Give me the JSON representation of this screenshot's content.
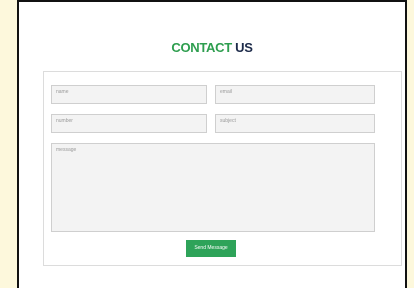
{
  "contact": {
    "title_part1": "CONTACT",
    "title_part2": "US",
    "fields": {
      "name_placeholder": "name",
      "email_placeholder": "email",
      "number_placeholder": "number",
      "subject_placeholder": "subject",
      "message_placeholder": "message"
    },
    "submit_label": "Send Message"
  },
  "colors": {
    "accent_green": "#2e9e4f",
    "title_dark": "#1d2b4a",
    "button_green": "#2ea359",
    "page_background": "#fdf8dc"
  }
}
